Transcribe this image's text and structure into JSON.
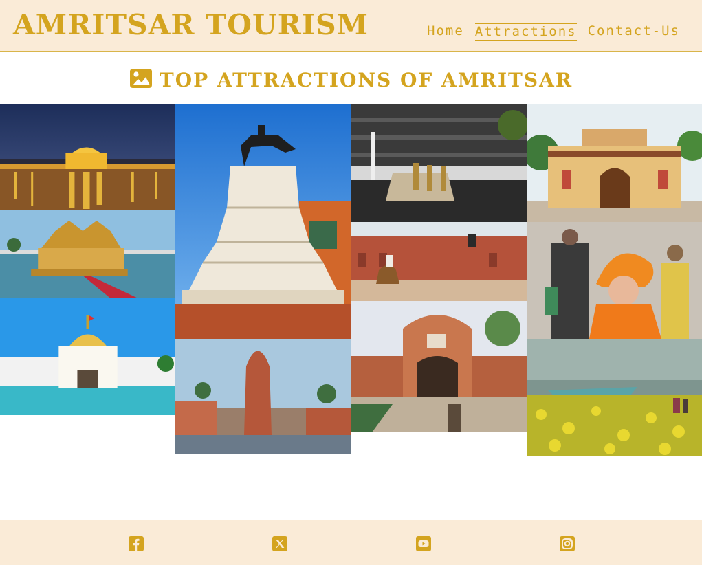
{
  "header": {
    "site_title": "AMRITSAR TOURISM",
    "nav": [
      {
        "label": "Home"
      },
      {
        "label": "Attractions"
      },
      {
        "label": "Contact-Us"
      }
    ],
    "active_nav": "Attractions"
  },
  "main": {
    "section_title": "TOP ATTRACTIONS OF AMRITSAR",
    "section_icon": "image-icon"
  },
  "gallery": {
    "photos": [
      {
        "icon": "golden-temple-night-photo"
      },
      {
        "icon": "temple-on-lake-photo"
      },
      {
        "icon": "white-gurudwara-photo"
      },
      {
        "icon": "ranjit-singh-statue-photo"
      },
      {
        "icon": "jallianwala-bagh-memorial-photo"
      },
      {
        "icon": "wagah-border-ceremony-photo"
      },
      {
        "icon": "gobindgarh-fort-camel-photo"
      },
      {
        "icon": "partition-museum-gate-photo"
      },
      {
        "icon": "painted-gate-photo"
      },
      {
        "icon": "child-in-turban-photo"
      },
      {
        "icon": "mustard-field-photo"
      }
    ]
  },
  "footer": {
    "social": [
      "facebook-icon",
      "x-twitter-icon",
      "youtube-icon",
      "instagram-icon"
    ]
  },
  "colors": {
    "accent": "#d4a41f",
    "header_bg": "#faebd7",
    "footer_bg": "#faebd7",
    "page_bg": "#ffffff"
  }
}
